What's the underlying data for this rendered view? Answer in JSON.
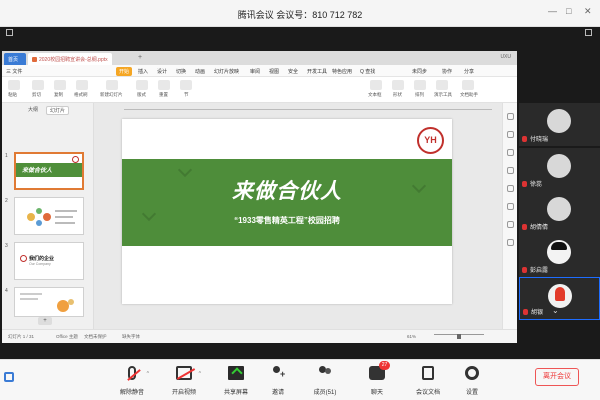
{
  "window": {
    "title": "腾讯会议  会议号：810 712 782",
    "controls": [
      "—",
      "□",
      "✕"
    ]
  },
  "wps": {
    "tabs": {
      "home": "首页",
      "doc": "2020校园招聘宣讲会-总纲.pptx",
      "right": "UXU"
    },
    "menu": [
      "三 文件",
      "开始",
      "插入",
      "设计",
      "切换",
      "动画",
      "幻灯片放映",
      "审阅",
      "视图",
      "安全",
      "开发工具",
      "特色应用",
      "Q 查找",
      "未同步",
      "协作",
      "分享"
    ],
    "ribbon": [
      "粘贴",
      "剪切",
      "复制",
      "格式刷",
      "新建幻灯片",
      "版式",
      "重置",
      "节",
      "文本框",
      "形状",
      "排列",
      "演示工具",
      "文档助手"
    ],
    "panel_tabs": [
      "大纲",
      "幻灯片"
    ],
    "slide_numbers": [
      "1",
      "2",
      "3",
      "4"
    ],
    "thumb1_text": "来做合伙人",
    "thumb3_title": "我们的企业",
    "thumb3_sub": "Our Company",
    "slide": {
      "headline": "来做合伙人",
      "subtitle": "“1933零售精英工程”校园招聘",
      "logo": "YH"
    },
    "status": {
      "slide_count": "幻灯片 1 / 31",
      "theme": "Office 主题",
      "backup": "文档未保护",
      "font": "缺失字体",
      "zoom": "61%"
    },
    "add_slide": "+"
  },
  "participants": [
    {
      "name": "付晓瑞"
    },
    {
      "name": "徐蕊"
    },
    {
      "name": "胡倩倩"
    },
    {
      "name": "彭启露"
    },
    {
      "name": "胡银"
    }
  ],
  "toolbar": {
    "mute": "解除静音",
    "video": "开启视频",
    "share": "共享屏幕",
    "invite": "邀请",
    "members": "成员(51)",
    "chat": "聊天",
    "chat_badge": "27",
    "docs": "会议文档",
    "settings": "设置",
    "leave": "离开会议"
  }
}
